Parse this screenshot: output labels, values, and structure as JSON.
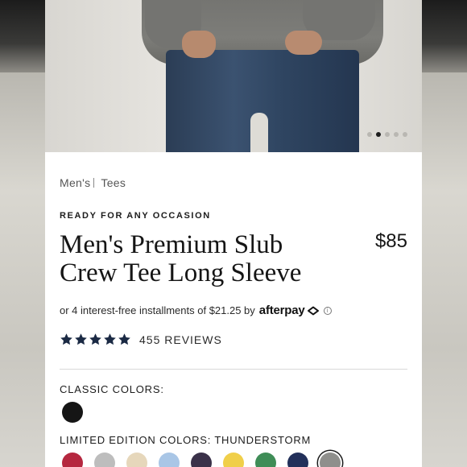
{
  "product": {
    "breadcrumb": [
      "Men's",
      "Tees"
    ],
    "eyebrow": "READY FOR ANY OCCASION",
    "title": "Men's Premium Slub Crew Tee Long Sleeve",
    "price": "$85",
    "installments_text": "or 4 interest-free installments of $21.25 by",
    "installments_provider": "afterpay",
    "rating": {
      "stars": 5,
      "reviews_label": "455 REVIEWS"
    }
  },
  "gallery": {
    "image_count": 5,
    "active_index": 1
  },
  "colors": {
    "classic_label": "CLASSIC COLORS:",
    "classic": [
      {
        "name": "black",
        "hex": "#151515"
      }
    ],
    "limited_label": "LIMITED EDITION COLORS: THUNDERSTORM",
    "limited": [
      {
        "name": "red",
        "hex": "#b5273f"
      },
      {
        "name": "gray",
        "hex": "#bdbdbd"
      },
      {
        "name": "sand",
        "hex": "#e6d7bb"
      },
      {
        "name": "light-blue",
        "hex": "#a9c6e6"
      },
      {
        "name": "plum",
        "hex": "#3a3149"
      },
      {
        "name": "yellow",
        "hex": "#f0cf4a"
      },
      {
        "name": "green",
        "hex": "#3f8d57"
      },
      {
        "name": "navy",
        "hex": "#22305a"
      },
      {
        "name": "thunderstorm",
        "hex": "#8f8f8c",
        "selected": true
      }
    ]
  },
  "theme": {
    "star_color": "#1b2a44"
  }
}
